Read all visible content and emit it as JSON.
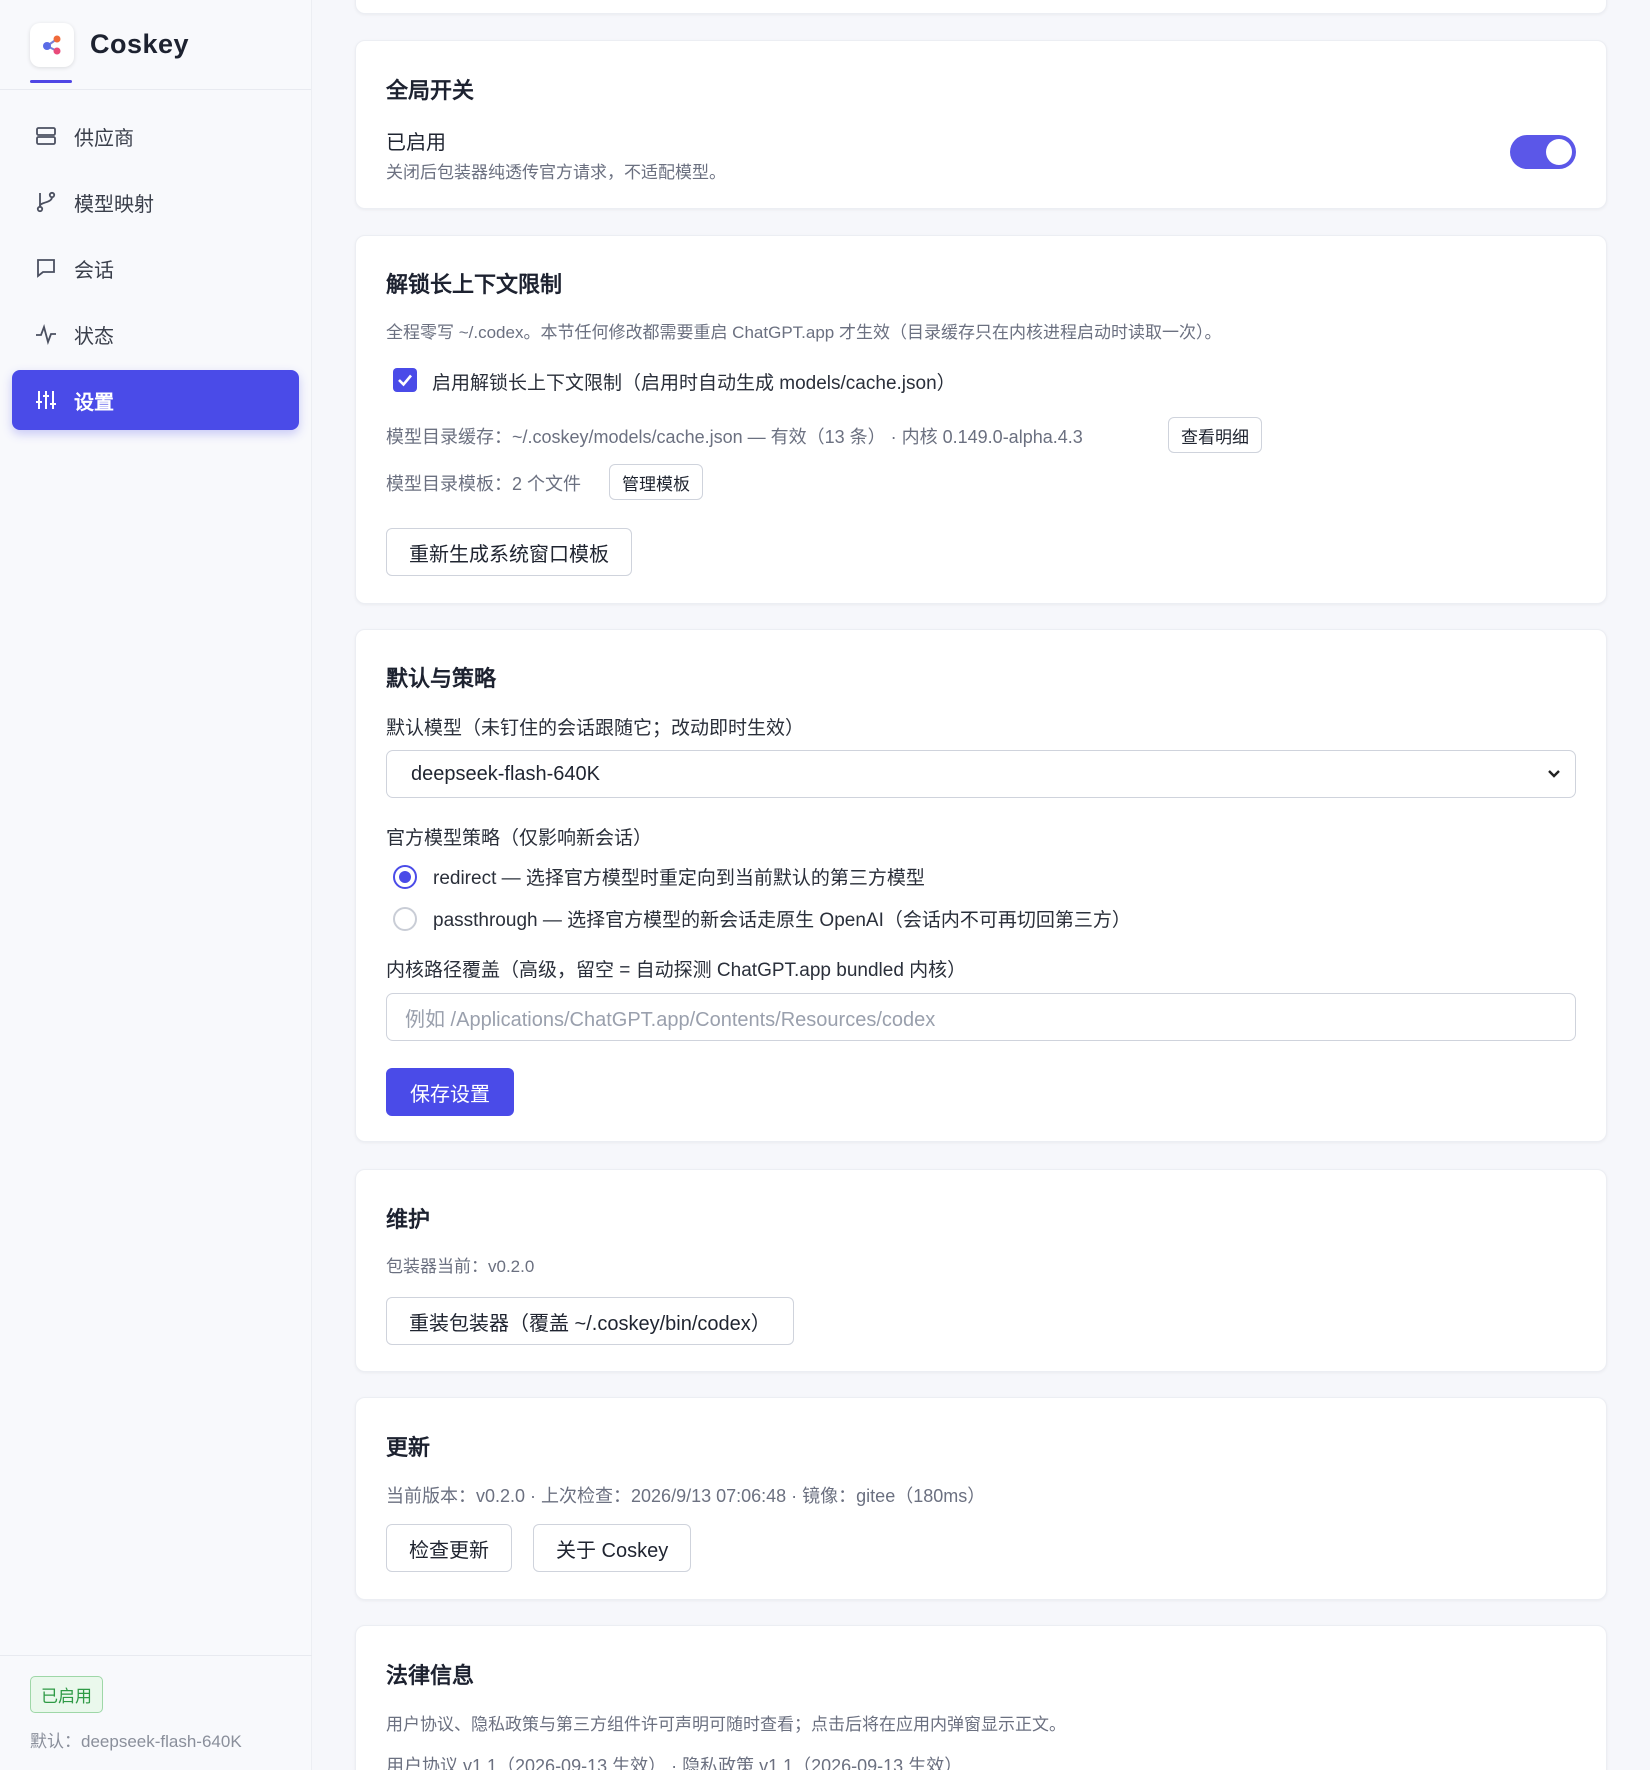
{
  "app": {
    "name": "Coskey"
  },
  "sidebar": {
    "items": [
      {
        "label": "供应商"
      },
      {
        "label": "模型映射"
      },
      {
        "label": "会话"
      },
      {
        "label": "状态"
      },
      {
        "label": "设置"
      }
    ],
    "footer": {
      "status": "已启用",
      "default_model": "默认：deepseek-flash-640K"
    }
  },
  "global_switch": {
    "title": "全局开关",
    "label": "已启用",
    "description": "关闭后包装器纯透传官方请求，不适配模型。",
    "enabled": true
  },
  "unlock": {
    "title": "解锁长上下文限制",
    "description": "全程零写 ~/.codex。本节任何修改都需要重启 ChatGPT.app 才生效（目录缓存只在内核进程启动时读取一次）。",
    "checkbox_label": "启用解锁长上下文限制（启用时自动生成 models/cache.json）",
    "checked": true,
    "cache_line": "模型目录缓存：~/.coskey/models/cache.json — 有效（13 条） · 内核 0.149.0-alpha.4.3",
    "view_details_button": "查看明细",
    "template_line": "模型目录模板：2 个文件",
    "manage_templates_button": "管理模板",
    "regenerate_button": "重新生成系统窗口模板"
  },
  "defaults": {
    "title": "默认与策略",
    "default_model_label": "默认模型（未钉住的会话跟随它；改动即时生效）",
    "default_model_value": "deepseek-flash-640K",
    "policy_label": "官方模型策略（仅影响新会话）",
    "policy_options": [
      {
        "label": "redirect — 选择官方模型时重定向到当前默认的第三方模型",
        "selected": true
      },
      {
        "label": "passthrough — 选择官方模型的新会话走原生 OpenAI（会话内不可再切回第三方）",
        "selected": false
      }
    ],
    "core_path_label": "内核路径覆盖（高级，留空 = 自动探测 ChatGPT.app bundled 内核）",
    "core_path_placeholder": "例如 /Applications/ChatGPT.app/Contents/Resources/codex",
    "save_button": "保存设置"
  },
  "maintenance": {
    "title": "维护",
    "current": "包装器当前：v0.2.0",
    "reinstall_button": "重装包装器（覆盖 ~/.coskey/bin/codex）"
  },
  "update": {
    "title": "更新",
    "info": "当前版本：v0.2.0 · 上次检查：2026/9/13 07:06:48 · 镜像：gitee（180ms）",
    "check_button": "检查更新",
    "about_button": "关于 Coskey"
  },
  "legal": {
    "title": "法律信息",
    "description": "用户协议、隐私政策与第三方组件许可声明可随时查看；点击后将在应用内弹窗显示正文。",
    "versions": "用户协议 v1.1（2026-09-13 生效） · 隐私政策 v1.1（2026-09-13 生效）"
  },
  "colors": {
    "accent": "#4a4be8",
    "success": "#2e9a45"
  }
}
